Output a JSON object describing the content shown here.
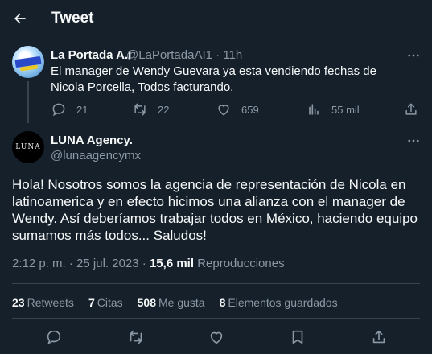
{
  "header": {
    "title": "Tweet",
    "back_icon": "arrow-left-icon"
  },
  "reply_context": {
    "name": "La Portada A.I",
    "handle": "@LaPortadaAI1",
    "separator": "·",
    "time": "11h",
    "text": "El manager de Wendy Guevara ya esta vendiendo fechas de Nicola Porcella, Todos facturando.",
    "actions": {
      "replies": "21",
      "retweets": "22",
      "likes": "659",
      "views": "55 mil"
    }
  },
  "tweet": {
    "name": "LUNA Agency.",
    "handle": "@lunaagencymx",
    "avatar_text": "LUNA",
    "text": "Hola! Nosotros somos la agencia de representación de Nicola en latinoamerica y en efecto hicimos una alianza con el manager de Wendy. Así deberíamos trabajar todos en México, haciendo equipo sumamos más todos... Saludos!",
    "time": "2:12 p. m.",
    "separator": "·",
    "date": "25 jul. 2023",
    "views_count": "15,6 mil",
    "views_label": "Reproducciones"
  },
  "stats": {
    "retweets_count": "23",
    "retweets_label": "Retweets",
    "quotes_count": "7",
    "quotes_label": "Citas",
    "likes_count": "508",
    "likes_label": "Me gusta",
    "bookmarks_count": "8",
    "bookmarks_label": "Elementos guardados"
  },
  "colors": {
    "background": "#15202b",
    "text": "#f7f9f9",
    "muted": "#8b98a5",
    "border": "#38444d"
  }
}
